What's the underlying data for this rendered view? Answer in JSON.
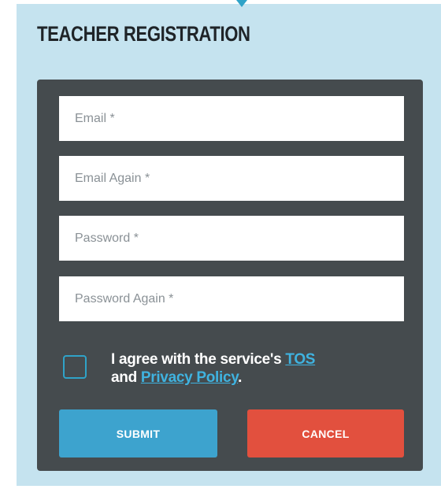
{
  "form": {
    "title": "TEACHER REGISTRATION",
    "fields": [
      {
        "placeholder": "Email *",
        "value": ""
      },
      {
        "placeholder": "Email Again *",
        "value": ""
      },
      {
        "placeholder": "Password *",
        "value": ""
      },
      {
        "placeholder": "Password Again *",
        "value": ""
      }
    ],
    "agreement": {
      "checked": false,
      "prefix": "I agree with the service's ",
      "tos_link": "TOS",
      "middle": " and ",
      "privacy_link": "Privacy Policy",
      "suffix": "."
    },
    "submit_label": "SUBMIT",
    "cancel_label": "CANCEL"
  },
  "colors": {
    "panel_background": "#c5e3ef",
    "card_background": "#454b4e",
    "accent": "#2fa3c8",
    "submit": "#3da3ce",
    "cancel": "#e2503e",
    "link": "#3fb3e0"
  }
}
